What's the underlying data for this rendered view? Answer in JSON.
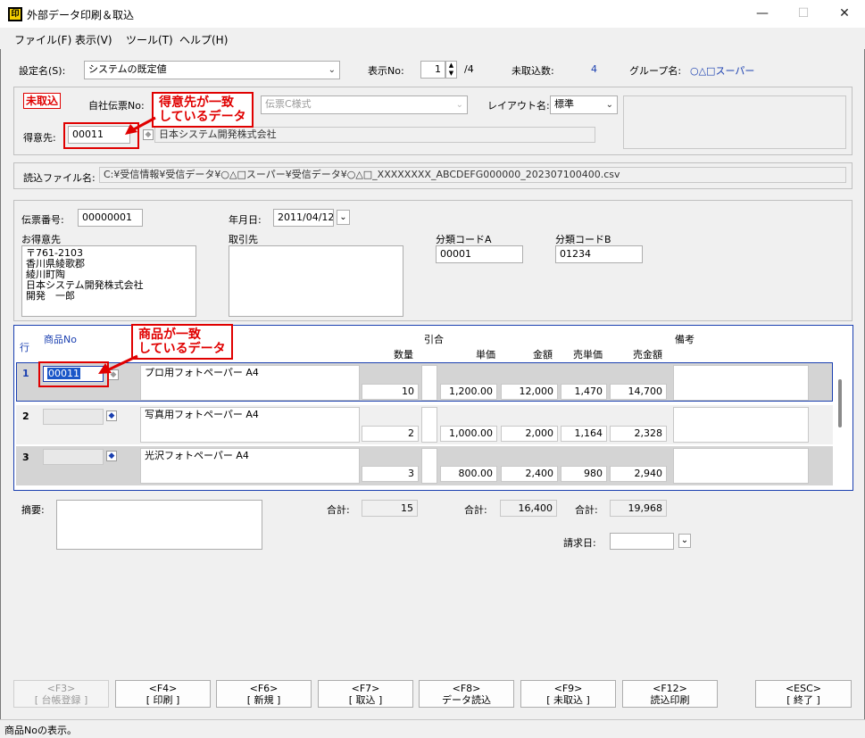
{
  "window": {
    "title": "外部データ印刷＆取込",
    "icon_text": "印",
    "controls": {
      "minimize": "—",
      "maximize": "☐",
      "close": "✕"
    }
  },
  "menu": [
    "ファイル(F)",
    "表示(V)",
    "ツール(T)",
    "ヘルプ(H)"
  ],
  "top": {
    "setting_label": "設定名(S):",
    "setting_value": "システムの既定値",
    "display_no_label": "表示No:",
    "display_no_value": "1",
    "display_no_total": "/4",
    "pending_label": "未取込数:",
    "pending_value": "4",
    "group_label": "グループ名:",
    "group_value": "○△□スーパー"
  },
  "header": {
    "status_badge": "未取込",
    "voucher_no_label": "自社伝票No:",
    "voucher_no_value": "伝票C様式",
    "layout_label": "レイアウト名:",
    "layout_value": "標準",
    "customer_label": "得意先:",
    "customer_code": "00011",
    "customer_name": "日本システム開発株式会社",
    "callout_customer": "得意先が一致\nしているデータ"
  },
  "file": {
    "label": "読込ファイル名:",
    "path": "C:¥受信情報¥受信データ¥○△□スーパー¥受信データ¥○△□_XXXXXXXX_ABCDEFG000000_202307100400.csv"
  },
  "slip": {
    "slip_no_label": "伝票番号:",
    "slip_no_value": "00000001",
    "date_label": "年月日:",
    "date_value": "2011/04/12",
    "customer_block_label": "お得意先",
    "customer_block_text": "〒761-2103\n香川県綾歌郡\n綾川町陶\n日本システム開発株式会社\n開発　一郎",
    "partner_label": "取引先",
    "class_a_label": "分類コードA",
    "class_a_value": "00001",
    "class_b_label": "分類コードB",
    "class_b_value": "01234"
  },
  "grid": {
    "headers": {
      "row": "行",
      "product_no": "商品No",
      "deduction": "引合",
      "qty": "数量",
      "unit_price": "単価",
      "amount": "金額",
      "sell_price": "売単価",
      "sell_amount": "売金額",
      "remarks": "備考"
    },
    "callout_product": "商品が一致\nしているデータ",
    "rows": [
      {
        "no": "1",
        "code": "00011",
        "name": "プロ用フォトペーパー A4",
        "qty": "10",
        "unit": "1,200.00",
        "amount": "12,000",
        "sell_unit": "1,470",
        "sell_amount": "14,700"
      },
      {
        "no": "2",
        "code": "",
        "name": "写真用フォトペーパー A4",
        "qty": "2",
        "unit": "1,000.00",
        "amount": "2,000",
        "sell_unit": "1,164",
        "sell_amount": "2,328"
      },
      {
        "no": "3",
        "code": "",
        "name": "光沢フォトペーパー A4",
        "qty": "3",
        "unit": "800.00",
        "amount": "2,400",
        "sell_unit": "980",
        "sell_amount": "2,940"
      }
    ]
  },
  "footer": {
    "memo_label": "摘要:",
    "total_label": "合計:",
    "qty_total": "15",
    "amount_total": "16,400",
    "sell_total": "19,968",
    "billing_date_label": "請求日:"
  },
  "fkeys": [
    {
      "key": "<F3>",
      "label": "[ 台帳登録 ]"
    },
    {
      "key": "<F4>",
      "label": "[ 印刷 ]"
    },
    {
      "key": "<F6>",
      "label": "[ 新規 ]"
    },
    {
      "key": "<F7>",
      "label": "[ 取込 ]"
    },
    {
      "key": "<F8>",
      "label": "データ読込"
    },
    {
      "key": "<F9>",
      "label": "[ 未取込 ]"
    },
    {
      "key": "<F12>",
      "label": "読込印刷"
    },
    {
      "key": "<ESC>",
      "label": "[ 終了 ]"
    }
  ],
  "statusbar": "商品Noの表示。",
  "colors": {
    "accent_red": "#e00000",
    "grid_border": "#1a3fb0",
    "selected_row": "#d4d4d4"
  }
}
